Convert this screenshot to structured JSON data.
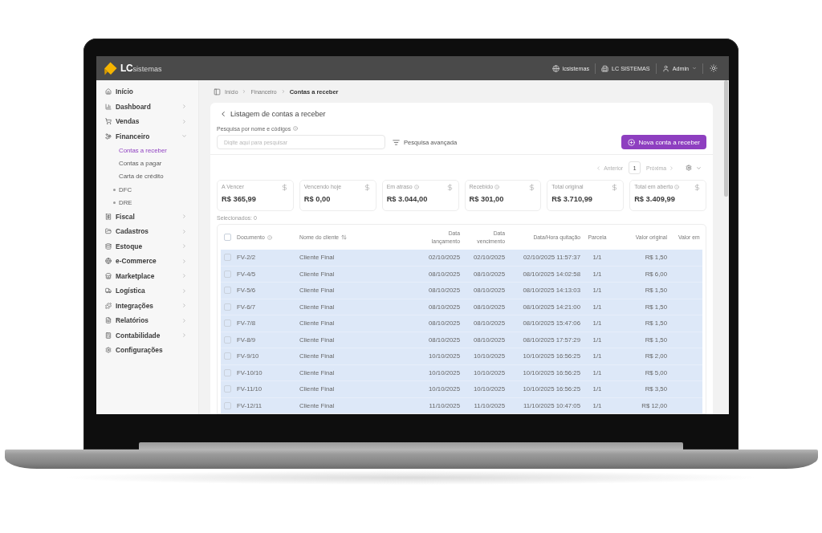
{
  "top_bar": {
    "logo": "**LC**sistemas",
    "items": [
      {
        "kind": "site",
        "label": "lcsistemas"
      },
      {
        "kind": "company",
        "label": "LC SISTEMAS"
      },
      {
        "kind": "user",
        "label": "Admin"
      }
    ]
  },
  "sidebar": {
    "items": [
      {
        "label": "Início",
        "selected": false
      },
      {
        "label": "Dashboard",
        "selected": false,
        "expanded": false
      },
      {
        "label": "Vendas",
        "selected": false,
        "expanded": false
      },
      {
        "label": "Financeiro",
        "selected": false,
        "expanded": true,
        "children": [
          {
            "kind": "link",
            "label": "Contas a receber",
            "selected": true
          },
          {
            "kind": "link",
            "label": "Contas a pagar",
            "selected": false
          },
          {
            "kind": "link",
            "label": "Carta de crédito",
            "selected": false
          },
          {
            "kind": "group",
            "label": "DFC",
            "selected": false
          },
          {
            "kind": "group",
            "label": "DRE",
            "selected": false
          }
        ]
      },
      {
        "label": "Fiscal",
        "selected": false,
        "expanded": false
      },
      {
        "label": "Cadastros",
        "selected": false,
        "expanded": false
      },
      {
        "label": "Estoque",
        "selected": false,
        "expanded": false
      },
      {
        "label": "e-Commerce",
        "selected": false,
        "expanded": false
      },
      {
        "label": "Marketplace",
        "selected": false,
        "expanded": false
      },
      {
        "label": "Logística",
        "selected": false,
        "expanded": false
      },
      {
        "label": "Integrações",
        "selected": false,
        "expanded": false
      },
      {
        "label": "Relatórios",
        "selected": false,
        "expanded": false
      },
      {
        "label": "Contabilidade",
        "selected": false,
        "expanded": false
      },
      {
        "label": "Configurações",
        "selected": false
      }
    ]
  },
  "breadcrumb": [
    "Início",
    "Financeiro",
    "Contas a receber"
  ],
  "page": {
    "title": "Listagem de contas a receber",
    "search": {
      "label": "Pesquisa por nome e códigos",
      "placeholder": "Digite aqui para pesquisar"
    },
    "advanced_search": "Pesquisa avançada",
    "new_button": "Nova conta a receber"
  },
  "pagination": {
    "previous": {
      "label": "Anterior",
      "disabled": true
    },
    "pages": [
      {
        "label": "1",
        "selected": true
      }
    ],
    "next": {
      "label": "Próxima",
      "disabled": true
    }
  },
  "stats": [
    {
      "label": "A Vencer",
      "value": "R$ 365,99"
    },
    {
      "label": "Vencendo hoje",
      "value": "R$ 0,00"
    },
    {
      "label": "Em atraso",
      "info": true,
      "value": "R$ 3.044,00"
    },
    {
      "label": "Recebido",
      "info": true,
      "value": "R$ 301,00"
    },
    {
      "label": "Total original",
      "value": "R$ 3.710,99"
    },
    {
      "label": "Total em aberto",
      "info": true,
      "value": "R$ 3.409,99"
    }
  ],
  "selection": "Selecionados: 0",
  "table": {
    "select_all": {
      "checked": false
    },
    "columns": [
      {
        "label": "Documento",
        "info": true
      },
      {
        "label": "Nome do cliente",
        "sortable": true
      },
      {
        "label": "Data lançamento"
      },
      {
        "label": "Data vencimento"
      },
      {
        "label": "Data/Hora quitação"
      },
      {
        "label": "Parcela"
      },
      {
        "label": "Valor original"
      },
      {
        "label": "Valor em"
      }
    ],
    "rows": [
      {
        "checked": false,
        "highlighted": true,
        "cells": [
          "FV-2/2",
          "Cliente Final",
          "02/10/2025",
          "02/10/2025",
          "02/10/2025 11:57:37",
          "1/1",
          "R$ 1,50"
        ]
      },
      {
        "checked": false,
        "highlighted": true,
        "cells": [
          "FV-4/5",
          "Cliente Final",
          "08/10/2025",
          "08/10/2025",
          "08/10/2025 14:02:58",
          "1/1",
          "R$ 6,00"
        ]
      },
      {
        "checked": false,
        "highlighted": true,
        "cells": [
          "FV-5/6",
          "Cliente Final",
          "08/10/2025",
          "08/10/2025",
          "08/10/2025 14:13:03",
          "1/1",
          "R$ 1,50"
        ]
      },
      {
        "checked": false,
        "highlighted": true,
        "cells": [
          "FV-6/7",
          "Cliente Final",
          "08/10/2025",
          "08/10/2025",
          "08/10/2025 14:21:00",
          "1/1",
          "R$ 1,50"
        ]
      },
      {
        "checked": false,
        "highlighted": true,
        "cells": [
          "FV-7/8",
          "Cliente Final",
          "08/10/2025",
          "08/10/2025",
          "08/10/2025 15:47:06",
          "1/1",
          "R$ 1,50"
        ]
      },
      {
        "checked": false,
        "highlighted": true,
        "cells": [
          "FV-8/9",
          "Cliente Final",
          "08/10/2025",
          "08/10/2025",
          "08/10/2025 17:57:29",
          "1/1",
          "R$ 1,50"
        ]
      },
      {
        "checked": false,
        "highlighted": true,
        "cells": [
          "FV-9/10",
          "Cliente Final",
          "10/10/2025",
          "10/10/2025",
          "10/10/2025 16:56:25",
          "1/1",
          "R$ 2,00"
        ]
      },
      {
        "checked": false,
        "highlighted": true,
        "cells": [
          "FV-10/10",
          "Cliente Final",
          "10/10/2025",
          "10/10/2025",
          "10/10/2025 16:56:25",
          "1/1",
          "R$ 5,00"
        ]
      },
      {
        "checked": false,
        "highlighted": true,
        "cells": [
          "FV-11/10",
          "Cliente Final",
          "10/10/2025",
          "10/10/2025",
          "10/10/2025 16:56:25",
          "1/1",
          "R$ 3,50"
        ]
      },
      {
        "checked": false,
        "highlighted": true,
        "cells": [
          "FV-12/11",
          "Cliente Final",
          "11/10/2025",
          "11/10/2025",
          "11/10/2025 10:47:05",
          "1/1",
          "R$ 12,00"
        ]
      }
    ]
  }
}
